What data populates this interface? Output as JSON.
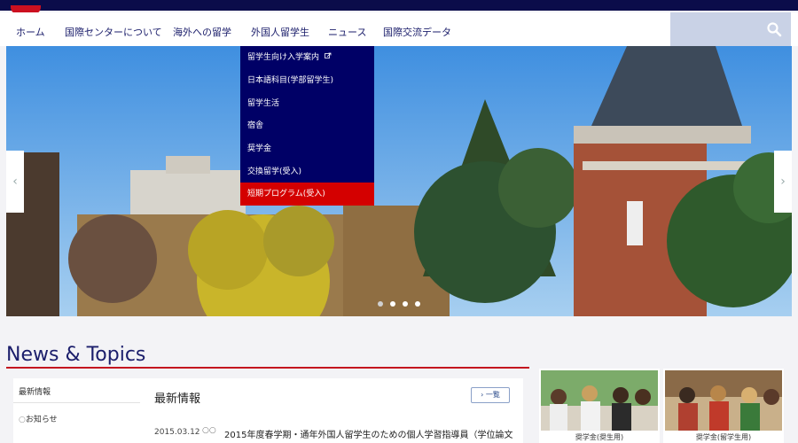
{
  "nav": {
    "items": [
      "ホーム",
      "国際センターについて",
      "海外への留学",
      "外国人留学生",
      "ニュース",
      "国際交流データ"
    ]
  },
  "dropdown": {
    "items": [
      "留学生向け入学案内",
      "日本語科目(学部留学生)",
      "留学生活",
      "宿舎",
      "奨学金",
      "交換留学(受入)",
      "短期プログラム(受入)"
    ],
    "active_index": 6
  },
  "carousel": {
    "slide_count": 4,
    "active_index": 0
  },
  "news": {
    "title": "News & Topics",
    "sidebar": {
      "item1": "最新情報",
      "item2": "お知らせ"
    },
    "heading": "最新情報",
    "list_button": "一覧",
    "entry": {
      "date": "2015.03.12",
      "text": "2015年度春学期・通年外国人留学生のための個人学習指導員（学位論文"
    }
  },
  "cards": [
    {
      "label": "奨学金(奨生用)"
    },
    {
      "label": "奨学金(留学生用)"
    }
  ],
  "colors": {
    "navy": "#000066",
    "brand_red": "#c4141f",
    "nav_text": "#1b1e6b"
  }
}
